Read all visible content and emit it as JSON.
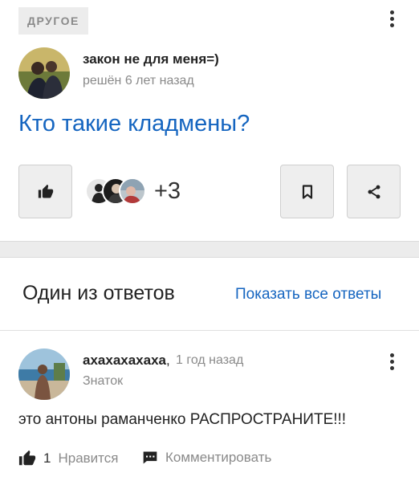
{
  "question": {
    "category": "ДРУГОЕ",
    "author": "закон не для меня=)",
    "status": "решён 6 лет назад",
    "title": "Кто такие кладмены?",
    "extra_likers": "+3"
  },
  "answers": {
    "section_title": "Один из ответов",
    "show_all": "Показать все ответы",
    "item": {
      "author": "ахахахахаха",
      "separator": ",",
      "time": "1 год назад",
      "rank": "Знаток",
      "text": "это антоны раманченко РАСПРОСТРАНИТЕ!!!",
      "likes": "1",
      "like_label": "Нравится",
      "comment_label": "Комментировать"
    }
  },
  "colors": {
    "link": "#1565c0",
    "muted": "#8a8a8a",
    "button_bg": "#eeeeee"
  },
  "icons": [
    "more-vert-icon",
    "thumb-up-icon",
    "bookmark-icon",
    "share-icon",
    "comment-icon"
  ]
}
